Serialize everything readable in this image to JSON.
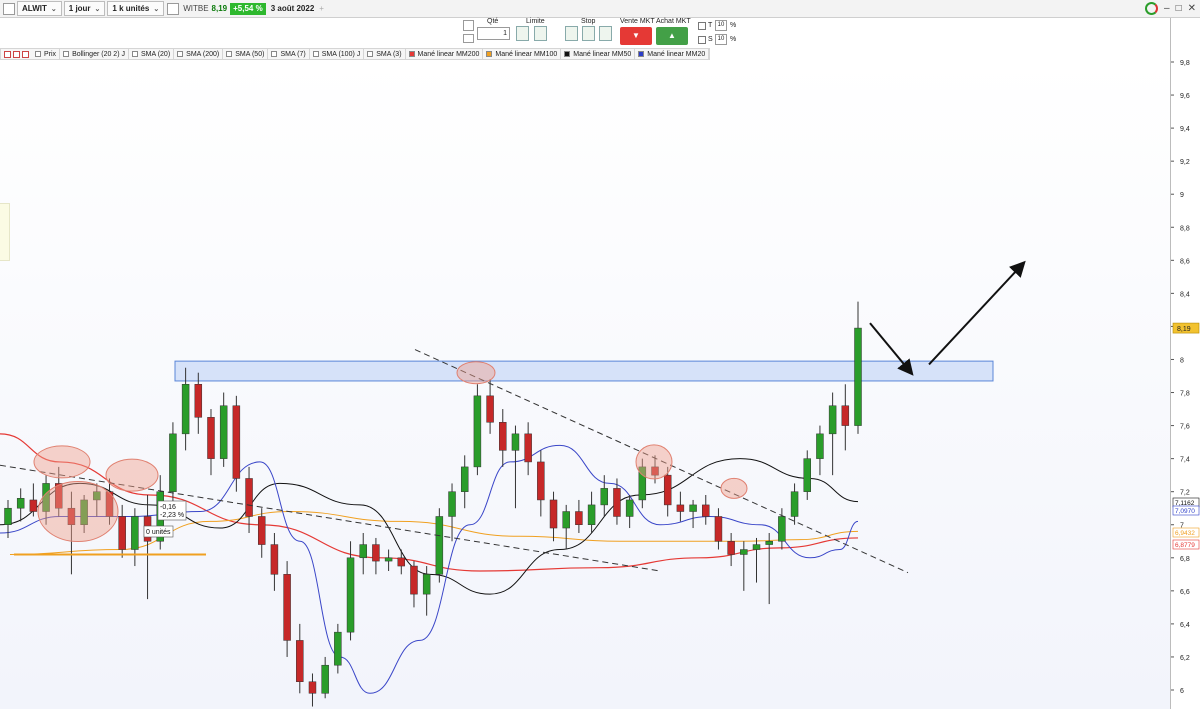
{
  "toolbar": {
    "list_name": "ALWIT",
    "period": "1 jour",
    "units": "1 k unités",
    "ticker": "WITBE",
    "price": "8,19",
    "change_pct": "+5,54 %",
    "date": "3 août 2022",
    "add": "+"
  },
  "window_controls": {
    "minimize": "–",
    "restore": "□",
    "close": "✕"
  },
  "order_panel": {
    "qty_label": "Qté",
    "qty_value": "1",
    "limit_label": "Limite",
    "stop_label": "Stop",
    "sell_mkt_label": "Vente MKT",
    "buy_mkt_label": "Achat MKT",
    "t_label": "T",
    "t_value": "10",
    "s_label": "S",
    "s_value": "10",
    "pct": "%"
  },
  "indicators": [
    {
      "label": "Prix",
      "color": "#ffffff"
    },
    {
      "label": "Bollinger (20 2) J",
      "color": "#ffffff"
    },
    {
      "label": "SMA (20)",
      "color": "#ffffff"
    },
    {
      "label": "SMA (200)",
      "color": "#ffffff"
    },
    {
      "label": "SMA (50)",
      "color": "#ffffff"
    },
    {
      "label": "SMA (7)",
      "color": "#ffffff"
    },
    {
      "label": "SMA (100) J",
      "color": "#ffffff"
    },
    {
      "label": "SMA (3)",
      "color": "#ffffff"
    },
    {
      "label": "Mané linear MM200",
      "color": "#e53935"
    },
    {
      "label": "Mané linear MM100",
      "color": "#f0a020"
    },
    {
      "label": "Mané linear MM50",
      "color": "#111111"
    },
    {
      "label": "Mané linear MM20",
      "color": "#2c3ec8"
    }
  ],
  "chart_data": {
    "type": "candlestick",
    "ylim": [
      5.94,
      9.93
    ],
    "y_ticks": [
      "9,8",
      "9,6",
      "9,4",
      "9,2",
      "9",
      "8,8",
      "8,6",
      "8,4",
      "8,2",
      "8",
      "7,8",
      "7,6",
      "7,4",
      "7,2",
      "7",
      "6,8",
      "6,6",
      "6,4",
      "6,2",
      "6"
    ],
    "last_price_label": "8,19",
    "ma_value_labels": [
      {
        "text": "7,1162",
        "color": "#111111",
        "value": 7.1162
      },
      {
        "text": "7,0970",
        "color": "#2c3ec8",
        "value": 7.097
      },
      {
        "text": "6,9432",
        "color": "#f0a020",
        "value": 6.943
      },
      {
        "text": "6,8779",
        "color": "#e53935",
        "value": 6.8779
      }
    ],
    "up_color": "#2a9d2a",
    "down_color": "#c62828",
    "candles": [
      [
        7.0,
        7.15,
        6.92,
        7.1
      ],
      [
        7.1,
        7.22,
        7.02,
        7.16
      ],
      [
        7.15,
        7.25,
        7.05,
        7.08
      ],
      [
        7.08,
        7.3,
        7.0,
        7.25
      ],
      [
        7.25,
        7.35,
        7.05,
        7.1
      ],
      [
        7.1,
        7.2,
        6.7,
        7.0
      ],
      [
        7.0,
        7.18,
        6.95,
        7.15
      ],
      [
        7.15,
        7.25,
        7.05,
        7.2
      ],
      [
        7.2,
        7.28,
        7.0,
        7.05
      ],
      [
        7.05,
        7.12,
        6.8,
        6.85
      ],
      [
        6.85,
        7.1,
        6.75,
        7.05
      ],
      [
        7.05,
        7.18,
        6.55,
        6.9
      ],
      [
        6.9,
        7.3,
        6.85,
        7.2
      ],
      [
        7.2,
        7.62,
        7.1,
        7.55
      ],
      [
        7.55,
        7.95,
        7.45,
        7.85
      ],
      [
        7.85,
        7.92,
        7.55,
        7.65
      ],
      [
        7.65,
        7.7,
        7.3,
        7.4
      ],
      [
        7.4,
        7.8,
        7.35,
        7.72
      ],
      [
        7.72,
        7.78,
        7.2,
        7.28
      ],
      [
        7.28,
        7.35,
        6.95,
        7.05
      ],
      [
        7.05,
        7.1,
        6.8,
        6.88
      ],
      [
        6.88,
        6.95,
        6.6,
        6.7
      ],
      [
        6.7,
        6.78,
        6.2,
        6.3
      ],
      [
        6.3,
        6.4,
        5.98,
        6.05
      ],
      [
        6.05,
        6.1,
        5.9,
        5.98
      ],
      [
        5.98,
        6.2,
        5.95,
        6.15
      ],
      [
        6.15,
        6.4,
        6.1,
        6.35
      ],
      [
        6.35,
        6.9,
        6.3,
        6.8
      ],
      [
        6.8,
        6.95,
        6.7,
        6.88
      ],
      [
        6.88,
        6.92,
        6.7,
        6.78
      ],
      [
        6.78,
        6.85,
        6.72,
        6.8
      ],
      [
        6.8,
        6.85,
        6.7,
        6.75
      ],
      [
        6.75,
        6.78,
        6.5,
        6.58
      ],
      [
        6.58,
        6.75,
        6.45,
        6.7
      ],
      [
        6.7,
        7.1,
        6.65,
        7.05
      ],
      [
        7.05,
        7.25,
        6.9,
        7.2
      ],
      [
        7.2,
        7.42,
        7.1,
        7.35
      ],
      [
        7.35,
        7.85,
        7.3,
        7.78
      ],
      [
        7.78,
        7.88,
        7.55,
        7.62
      ],
      [
        7.62,
        7.7,
        7.35,
        7.45
      ],
      [
        7.45,
        7.6,
        7.1,
        7.55
      ],
      [
        7.55,
        7.62,
        7.3,
        7.38
      ],
      [
        7.38,
        7.45,
        7.05,
        7.15
      ],
      [
        7.15,
        7.2,
        6.9,
        6.98
      ],
      [
        6.98,
        7.12,
        6.85,
        7.08
      ],
      [
        7.08,
        7.15,
        6.95,
        7.0
      ],
      [
        7.0,
        7.2,
        6.95,
        7.12
      ],
      [
        7.12,
        7.3,
        7.05,
        7.22
      ],
      [
        7.22,
        7.28,
        7.0,
        7.05
      ],
      [
        7.05,
        7.18,
        6.98,
        7.15
      ],
      [
        7.15,
        7.4,
        7.1,
        7.35
      ],
      [
        7.35,
        7.42,
        7.25,
        7.3
      ],
      [
        7.3,
        7.35,
        7.05,
        7.12
      ],
      [
        7.12,
        7.2,
        7.02,
        7.08
      ],
      [
        7.08,
        7.15,
        6.98,
        7.12
      ],
      [
        7.12,
        7.18,
        7.0,
        7.05
      ],
      [
        7.05,
        7.1,
        6.85,
        6.9
      ],
      [
        6.9,
        6.95,
        6.75,
        6.82
      ],
      [
        6.82,
        6.9,
        6.6,
        6.85
      ],
      [
        6.85,
        6.92,
        6.65,
        6.88
      ],
      [
        6.88,
        6.95,
        6.52,
        6.9
      ],
      [
        6.9,
        7.1,
        6.85,
        7.05
      ],
      [
        7.05,
        7.25,
        7.0,
        7.2
      ],
      [
        7.2,
        7.45,
        7.15,
        7.4
      ],
      [
        7.4,
        7.6,
        7.3,
        7.55
      ],
      [
        7.55,
        7.8,
        7.3,
        7.72
      ],
      [
        7.72,
        7.85,
        7.45,
        7.6
      ],
      [
        7.6,
        8.35,
        7.55,
        8.19
      ]
    ]
  },
  "annotations": {
    "pnl_value": "-0,16",
    "pnl_pct": "-2,23 %",
    "position_label": "0 unités"
  }
}
